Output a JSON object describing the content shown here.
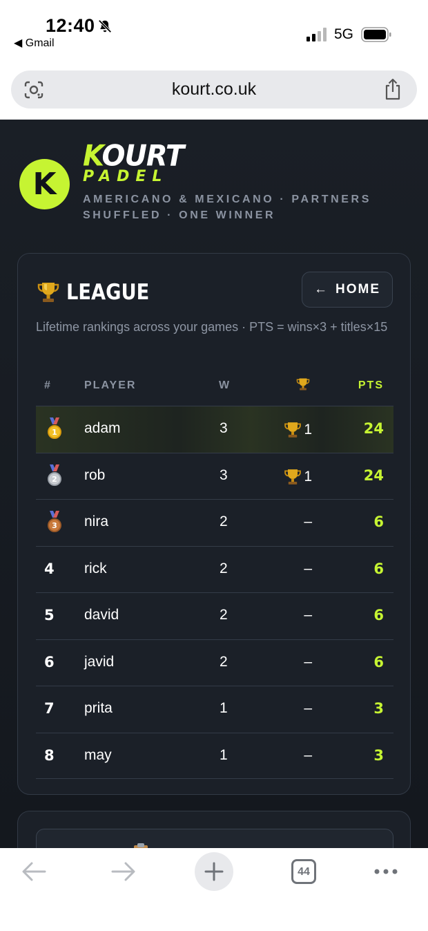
{
  "status_bar": {
    "time": "12:40",
    "back_app": "◀ Gmail",
    "network": "5G"
  },
  "browser": {
    "url": "kourt.co.uk",
    "tab_count": "44"
  },
  "brand": {
    "k": "K",
    "name_rest": "OURT",
    "logo_letter": "K",
    "sub": "PADEL",
    "tagline": "AMERICANO & MEXICANO · PARTNERS SHUFFLED · ONE WINNER"
  },
  "league": {
    "title": "LEAGUE",
    "home_button": "HOME",
    "description": "Lifetime rankings across your games · PTS = wins×3 + titles×15",
    "columns": {
      "rank": "#",
      "player": "PLAYER",
      "wins": "W",
      "titles": "trophy-icon",
      "points": "PTS"
    },
    "rows": [
      {
        "rank": "1",
        "medal": "gold",
        "player": "adam",
        "wins": "3",
        "titles": "1",
        "points": "24"
      },
      {
        "rank": "2",
        "medal": "silver",
        "player": "rob",
        "wins": "3",
        "titles": "1",
        "points": "24"
      },
      {
        "rank": "3",
        "medal": "bronze",
        "player": "nira",
        "wins": "2",
        "titles": "–",
        "points": "6"
      },
      {
        "rank": "4",
        "medal": "",
        "player": "rick",
        "wins": "2",
        "titles": "–",
        "points": "6"
      },
      {
        "rank": "5",
        "medal": "",
        "player": "david",
        "wins": "2",
        "titles": "–",
        "points": "6"
      },
      {
        "rank": "6",
        "medal": "",
        "player": "javid",
        "wins": "2",
        "titles": "–",
        "points": "6"
      },
      {
        "rank": "7",
        "medal": "",
        "player": "prita",
        "wins": "1",
        "titles": "–",
        "points": "3"
      },
      {
        "rank": "8",
        "medal": "",
        "player": "may",
        "wins": "1",
        "titles": "–",
        "points": "3"
      }
    ]
  },
  "colors": {
    "accent": "#c6f432",
    "background": "#171b21",
    "card": "#1b2028",
    "muted": "#8b93a1"
  }
}
